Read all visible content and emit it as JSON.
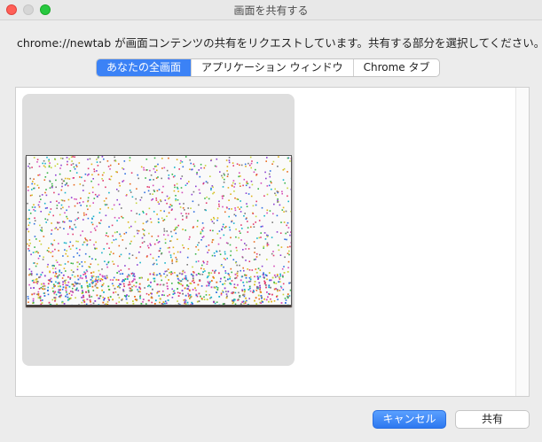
{
  "window": {
    "title": "画面を共有する",
    "prompt": "chrome://newtab が画面コンテンツの共有をリクエストしています。共有する部分を選択してください。"
  },
  "tabs": [
    {
      "label": "あなたの全画面",
      "selected": true
    },
    {
      "label": "アプリケーション ウィンドウ",
      "selected": false
    },
    {
      "label": "Chrome タブ",
      "selected": false
    }
  ],
  "buttons": {
    "cancel": "キャンセル",
    "share": "共有"
  },
  "colors": {
    "accent": "#3b82f6",
    "close": "#ff5f57",
    "maximize": "#28c840"
  }
}
